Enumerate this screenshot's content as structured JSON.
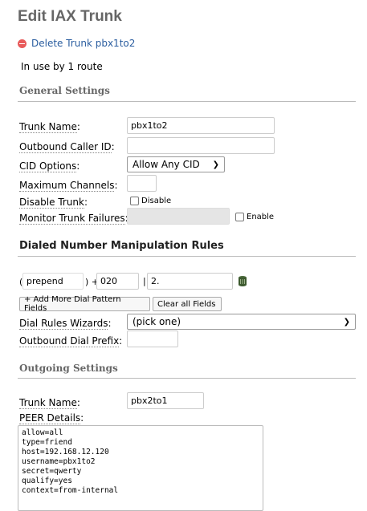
{
  "page": {
    "title": "Edit IAX Trunk"
  },
  "delete": {
    "label": "Delete Trunk pbx1to2"
  },
  "usage": {
    "text": "In use by 1 route"
  },
  "general": {
    "heading": "General Settings",
    "trunk_name_label": "Trunk Name",
    "trunk_name_value": "pbx1to2",
    "outbound_cid_label": "Outbound Caller ID",
    "outbound_cid_value": "",
    "cid_options_label": "CID Options",
    "cid_options_value": "Allow Any CID",
    "max_channels_label": "Maximum Channels",
    "max_channels_value": "",
    "disable_trunk_label": "Disable Trunk",
    "disable_checkbox_label": "Disable",
    "monitor_label": "Monitor Trunk Failures",
    "monitor_value": "",
    "enable_checkbox_label": "Enable"
  },
  "dial": {
    "heading": "Dialed Number Manipulation Rules",
    "open_paren": "(",
    "prepend_value": "prepend",
    "close_paren_plus": ") +",
    "prefix_value": "020",
    "pipe": "|",
    "pattern_value": "2.",
    "add_more_label": "+ Add More Dial Pattern Fields",
    "clear_all_label": "Clear all Fields",
    "wizards_label": "Dial Rules Wizards",
    "wizards_value": "(pick one)",
    "outbound_prefix_label": "Outbound Dial Prefix",
    "outbound_prefix_value": ""
  },
  "outgoing": {
    "heading": "Outgoing Settings",
    "trunk_name_label": "Trunk Name",
    "trunk_name_value": "pbx2to1",
    "peer_label": "PEER Details",
    "peer_value": "allow=all\ntype=friend\nhost=192.168.12.120\nusername=pbx1to2\nsecret=qwerty\nqualify=yes\ncontext=from-internal"
  },
  "icons": {
    "delete": "remove-circle-icon",
    "trash": "trash-icon",
    "chevron": "chevron-down-icon"
  },
  "colors": {
    "link": "#2a5d9f",
    "delete_icon": "#e85a5a",
    "heading": "#666666"
  }
}
